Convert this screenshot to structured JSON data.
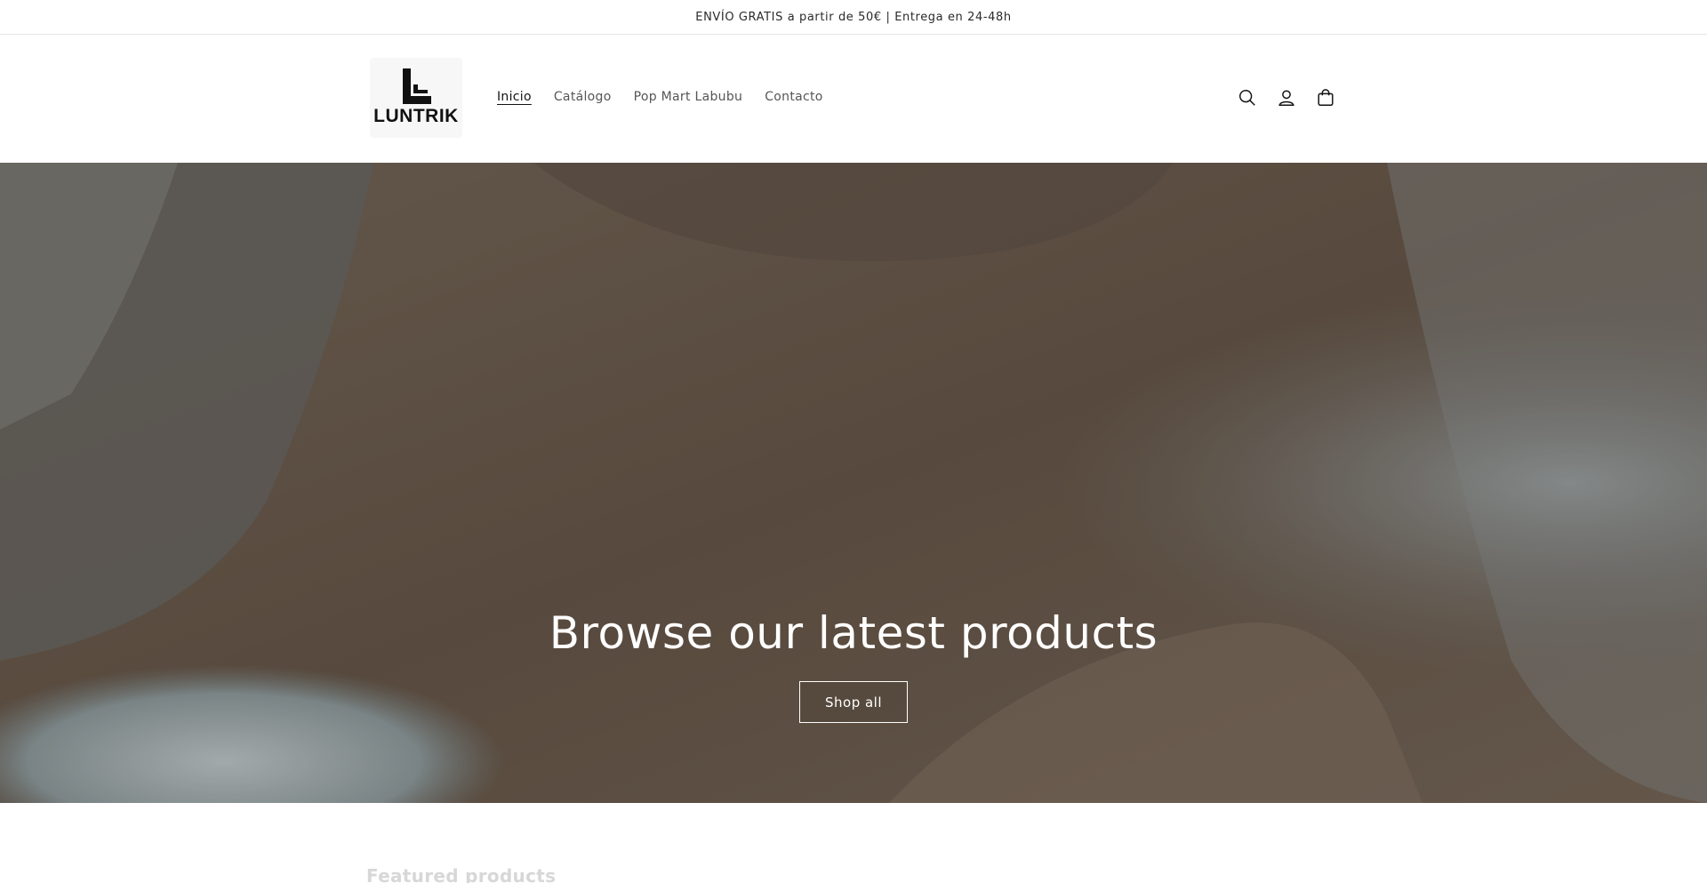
{
  "announcement": {
    "text": "ENVÍO GRATIS a partir de 50€ | Entrega en 24-48h"
  },
  "header": {
    "logo_text": "LUNTRIK",
    "nav": [
      {
        "label": "Inicio",
        "active": true
      },
      {
        "label": "Catálogo",
        "active": false
      },
      {
        "label": "Pop Mart Labubu",
        "active": false
      },
      {
        "label": "Contacto",
        "active": false
      }
    ],
    "icons": [
      "search-icon",
      "account-icon",
      "cart-icon"
    ]
  },
  "hero": {
    "title": "Browse our latest products",
    "button_label": "Shop all"
  },
  "featured": {
    "title": "Featured products"
  },
  "colors": {
    "text": "#121212",
    "hero_base": "#6a5a4c",
    "white": "#ffffff"
  }
}
